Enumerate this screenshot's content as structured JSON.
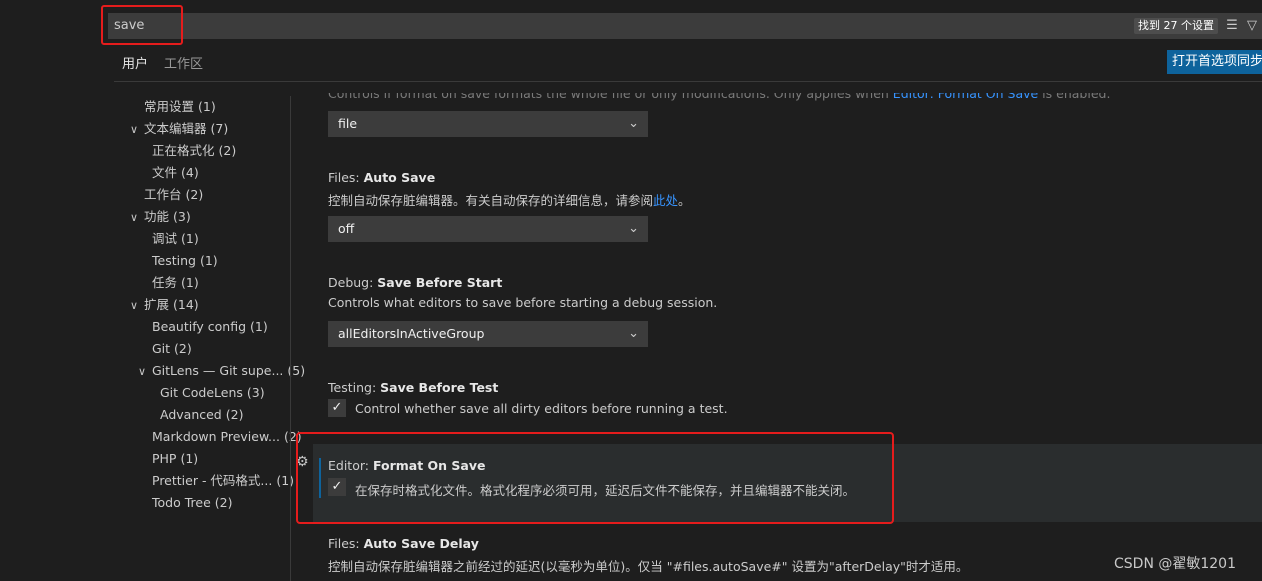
{
  "search": {
    "value": "save",
    "results_badge": "找到 27 个设置"
  },
  "tabs": [
    {
      "label": "用户",
      "active": true
    },
    {
      "label": "工作区",
      "active": false
    }
  ],
  "sync_button": "打开首选项同步",
  "toc": [
    {
      "label": "常用设置",
      "count": "(1)"
    },
    {
      "label": "文本编辑器",
      "count": "(7)",
      "expanded": true
    },
    {
      "label": "正在格式化",
      "count": "(2)"
    },
    {
      "label": "文件",
      "count": "(4)"
    },
    {
      "label": "工作台",
      "count": "(2)"
    },
    {
      "label": "功能",
      "count": "(3)",
      "expanded": true
    },
    {
      "label": "调试",
      "count": "(1)"
    },
    {
      "label": "Testing",
      "count": "(1)"
    },
    {
      "label": "任务",
      "count": "(1)"
    },
    {
      "label": "扩展",
      "count": "(14)",
      "expanded": true
    },
    {
      "label": "Beautify config",
      "count": "(1)"
    },
    {
      "label": "Git",
      "count": "(2)"
    },
    {
      "label": "GitLens — Git supe...",
      "count": "(5)",
      "expanded": true
    },
    {
      "label": "Git CodeLens",
      "count": "(3)"
    },
    {
      "label": "Advanced",
      "count": "(2)"
    },
    {
      "label": "Markdown Preview...",
      "count": "(2)"
    },
    {
      "label": "PHP",
      "count": "(1)"
    },
    {
      "label": "Prettier - 代码格式...",
      "count": "(1)"
    },
    {
      "label": "Todo Tree",
      "count": "(2)"
    }
  ],
  "settings": {
    "ghost_desc": {
      "pre": "Controls if format on save formats the whole file or only modifications. Only applies when ",
      "link": "Editor: Format On Save",
      "post": " is enabled."
    },
    "format_on_save_mode_value": "file",
    "auto_save": {
      "category": "Files: ",
      "name": "Auto Save",
      "desc_pre": "控制自动保存脏编辑器。有关自动保存的详细信息，请参阅",
      "desc_link": "此处",
      "desc_post": "。",
      "value": "off"
    },
    "save_before_start": {
      "category": "Debug: ",
      "name": "Save Before Start",
      "desc": "Controls what editors to save before starting a debug session.",
      "value": "allEditorsInActiveGroup"
    },
    "save_before_test": {
      "category": "Testing: ",
      "name": "Save Before Test",
      "desc": "Control whether save all dirty editors before running a test.",
      "checked": true
    },
    "format_on_save": {
      "category": "Editor: ",
      "name": "Format On Save",
      "desc": "在保存时格式化文件。格式化程序必须可用，延迟后文件不能保存，并且编辑器不能关闭。",
      "checked": true
    },
    "auto_save_delay": {
      "category": "Files: ",
      "name": "Auto Save Delay",
      "desc": "控制自动保存脏编辑器之前经过的延迟(以毫秒为单位)。仅当 \"#files.autoSave#\" 设置为\"afterDelay\"时才适用。"
    }
  },
  "icons": {
    "check": "✓",
    "chevron_down": "⌄",
    "chevron_expanded": "∨",
    "gear": "⚙"
  },
  "watermark": "CSDN @翟敏1201"
}
